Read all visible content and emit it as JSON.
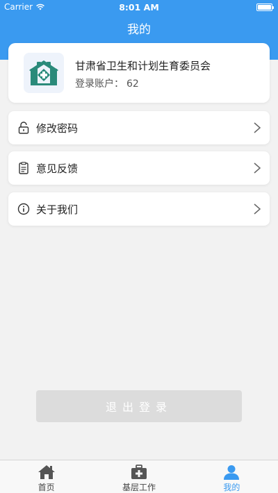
{
  "status_bar": {
    "carrier": "Carrier",
    "time": "8:01 AM"
  },
  "header": {
    "title": "我的"
  },
  "profile": {
    "org_name": "甘肃省卫生和计划生育委员会",
    "account_label": "登录账户：",
    "account_value": "62"
  },
  "menu": {
    "items": [
      {
        "label": "修改密码",
        "icon": "lock-icon"
      },
      {
        "label": "意见反馈",
        "icon": "feedback-icon"
      },
      {
        "label": "关于我们",
        "icon": "info-icon"
      }
    ]
  },
  "logout": {
    "label": "退出登录"
  },
  "tab_bar": {
    "tabs": [
      {
        "label": "首页",
        "icon": "home-icon",
        "active": false
      },
      {
        "label": "基层工作",
        "icon": "medical-kit-icon",
        "active": false
      },
      {
        "label": "我的",
        "icon": "person-icon",
        "active": true
      }
    ]
  },
  "colors": {
    "accent": "#3a9af0",
    "logo_green": "#2a8a7a",
    "background": "#f2f2f2"
  }
}
